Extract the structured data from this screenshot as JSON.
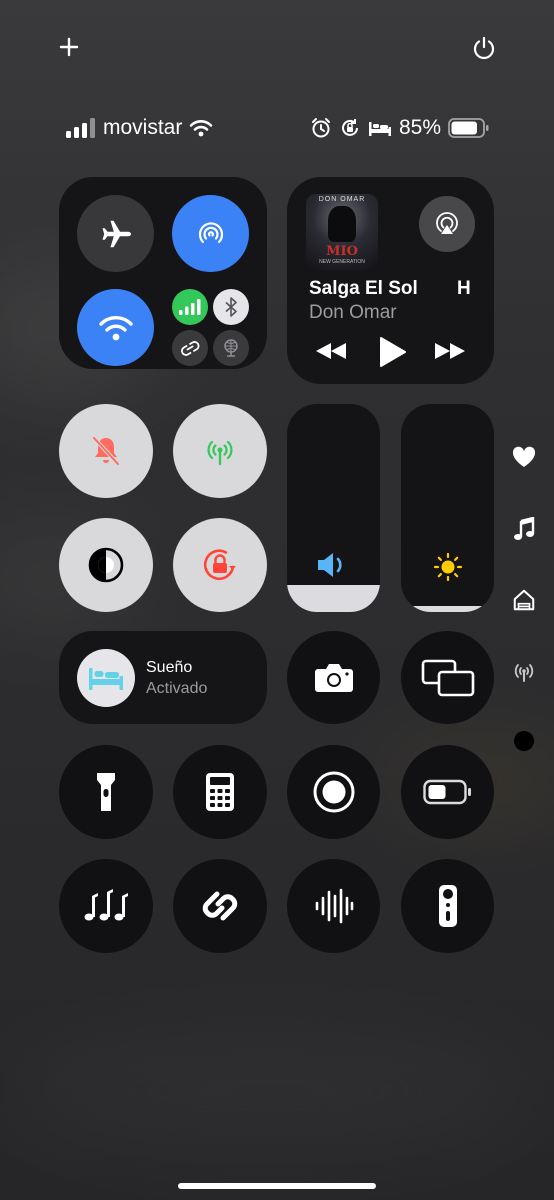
{
  "status_bar": {
    "carrier": "movistar",
    "battery_percent": "85%",
    "battery_level": 0.85
  },
  "media": {
    "song_title": "Salga El Sol",
    "next_title_fragment": "H",
    "artist": "Don Omar",
    "album_art_text": "DON OMAR",
    "album_art_logo": "MIO",
    "album_art_sub": "NEW GENERATION"
  },
  "sliders": {
    "volume_level": 0.13,
    "brightness_level": 0.03
  },
  "sleep": {
    "title": "Sueño",
    "status": "Activado"
  },
  "colors": {
    "accent_blue": "#3b82f6",
    "cellular_green": "#34c759",
    "alert_red": "#ff453a",
    "sleep_teal": "#63d2e8",
    "sun_yellow": "#ffcc00",
    "volume_blue": "#5ab4f8"
  },
  "icons": [
    "plus-icon",
    "power-icon",
    "wifi-icon",
    "airplane-icon",
    "airdrop-icon",
    "cellular-icon",
    "bluetooth-icon",
    "hotspot-link-icon",
    "vpn-globe-icon",
    "airplay-icon",
    "rewind-icon",
    "play-icon",
    "fast-forward-icon",
    "bell-slash-icon",
    "antenna-icon",
    "dark-mode-icon",
    "rotation-lock-icon",
    "speaker-icon",
    "sun-icon",
    "bed-icon",
    "camera-icon",
    "screen-mirror-icon",
    "flashlight-icon",
    "calculator-icon",
    "record-icon",
    "low-power-icon",
    "music-recognition-icon",
    "shazam-icon",
    "sound-wave-icon",
    "tv-remote-icon",
    "heart-icon",
    "music-note-icon",
    "home-icon",
    "antenna-side-icon",
    "dot-icon"
  ]
}
